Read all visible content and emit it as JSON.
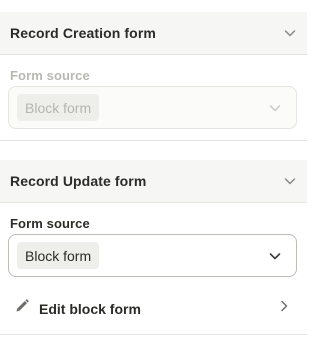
{
  "creation_section": {
    "title": "Record Creation form",
    "field_label": "Form source",
    "selected_value": "Block form",
    "disabled": true
  },
  "update_section": {
    "title": "Record Update form",
    "field_label": "Form source",
    "selected_value": "Block form",
    "disabled": false
  },
  "edit_action": {
    "label": "Edit block form",
    "icon": "pencil-icon"
  },
  "colors": {
    "header_bg": "#f6f6f4",
    "border": "#e4e4e0",
    "chip_bg": "#eeeeea",
    "disabled_text": "#b5b5b0",
    "text": "#2b2b28"
  }
}
